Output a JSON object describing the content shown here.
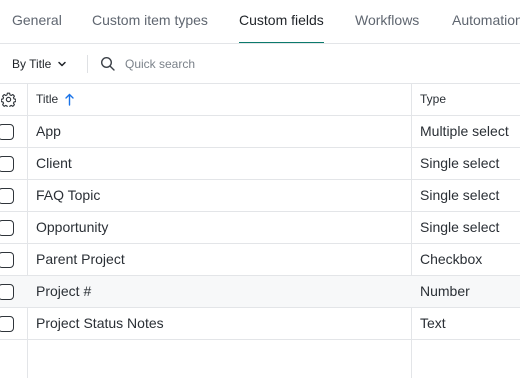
{
  "tabs": [
    {
      "label": "General",
      "active": false
    },
    {
      "label": "Custom item types",
      "active": false
    },
    {
      "label": "Custom fields",
      "active": true
    },
    {
      "label": "Workflows",
      "active": false
    },
    {
      "label": "Automation",
      "active": false
    }
  ],
  "toolbar": {
    "sort_label": "By Title",
    "search_placeholder": "Quick search"
  },
  "table": {
    "columns": {
      "title": "Title",
      "type": "Type"
    },
    "sorted_by": "Title",
    "sort_direction": "ascending",
    "rows": [
      {
        "title": "App",
        "type": "Multiple select"
      },
      {
        "title": "Client",
        "type": "Single select"
      },
      {
        "title": "FAQ Topic",
        "type": "Single select"
      },
      {
        "title": "Opportunity",
        "type": "Single select"
      },
      {
        "title": "Parent Project",
        "type": "Checkbox"
      },
      {
        "title": "Project #",
        "type": "Number"
      },
      {
        "title": "Project Status Notes",
        "type": "Text"
      }
    ]
  },
  "colors": {
    "accent": "#0b7a6c",
    "border": "#e3e5e8",
    "sort_arrow": "#1a73e8",
    "hover_row": "#f7f8f9"
  },
  "icons": {
    "settings": "gear-icon",
    "sort_dropdown": "chevron-down-icon",
    "search": "search-icon",
    "sort_indicator": "arrow-up-icon"
  }
}
